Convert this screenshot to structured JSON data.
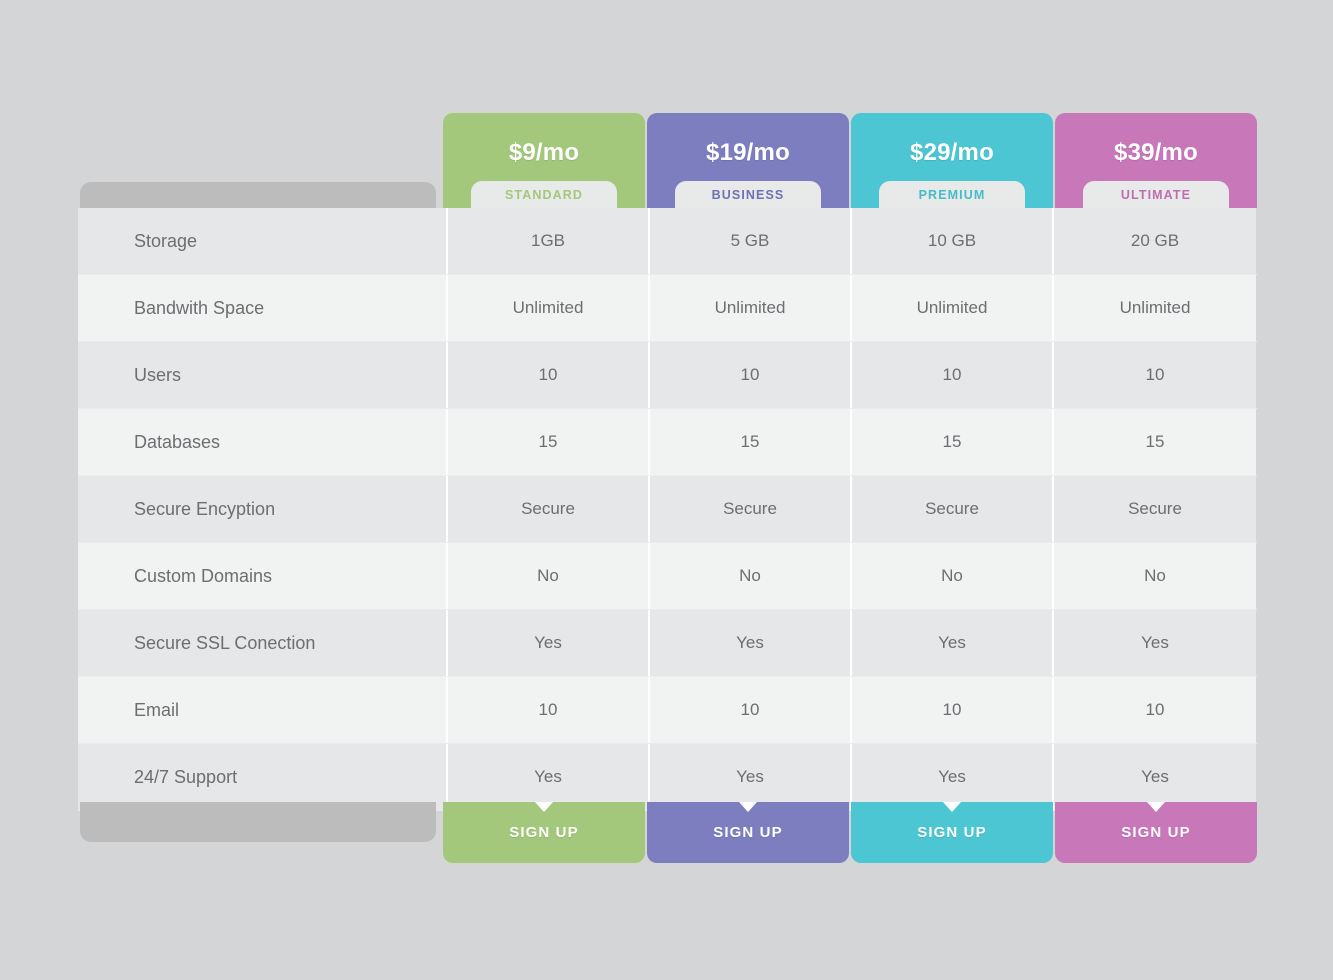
{
  "background_color": "#d4d5d7",
  "plans": [
    {
      "price": "$9/mo",
      "badge": "STANDARD",
      "signup": "SIGN UP",
      "color": "#a4c87b",
      "badge_text_color": "#a4c87b"
    },
    {
      "price": "$19/mo",
      "badge": "BUSINESS",
      "signup": "SIGN UP",
      "color": "#7d7ec0",
      "badge_text_color": "#6f70b5"
    },
    {
      "price": "$29/mo",
      "badge": "PREMIUM",
      "signup": "SIGN UP",
      "color": "#4cc6d2",
      "badge_text_color": "#45bcc9"
    },
    {
      "price": "$39/mo",
      "badge": "ULTIMATE",
      "signup": "SIGN UP",
      "color": "#c877b8",
      "badge_text_color": "#bf6db0"
    }
  ],
  "rows": [
    {
      "feature": "Storage",
      "values": [
        "1GB",
        "5 GB",
        "10 GB",
        "20 GB"
      ]
    },
    {
      "feature": "Bandwith Space",
      "values": [
        "Unlimited",
        "Unlimited",
        "Unlimited",
        "Unlimited"
      ]
    },
    {
      "feature": "Users",
      "values": [
        "10",
        "10",
        "10",
        "10"
      ]
    },
    {
      "feature": "Databases",
      "values": [
        "15",
        "15",
        "15",
        "15"
      ]
    },
    {
      "feature": "Secure Encyption",
      "values": [
        "Secure",
        "Secure",
        "Secure",
        "Secure"
      ]
    },
    {
      "feature": "Custom Domains",
      "values": [
        "No",
        "No",
        "No",
        "No"
      ]
    },
    {
      "feature": "Secure SSL Conection",
      "values": [
        "Yes",
        "Yes",
        "Yes",
        "Yes"
      ]
    },
    {
      "feature": "Email",
      "values": [
        "10",
        "10",
        "10",
        "10"
      ]
    },
    {
      "feature": "24/7 Support",
      "values": [
        "Yes",
        "Yes",
        "Yes",
        "Yes"
      ]
    }
  ]
}
